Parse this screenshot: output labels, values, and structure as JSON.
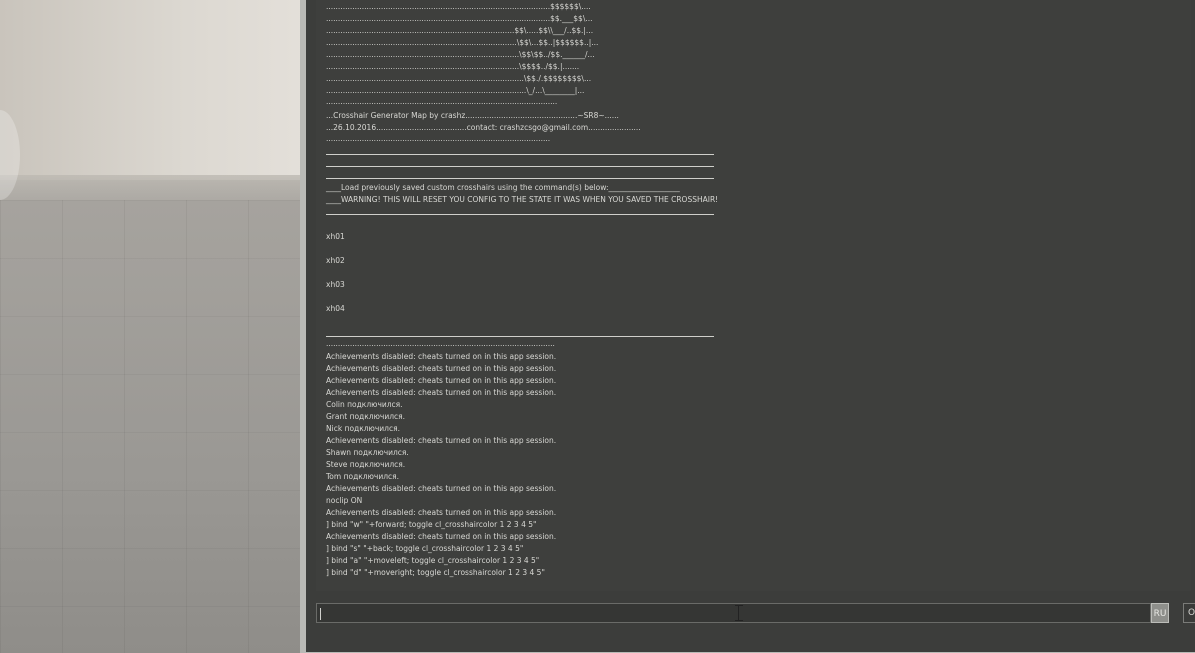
{
  "console": {
    "ascii_art": [
      "..............................................................................................$$$$$$\\....",
      "..............................................................................................$$.___$$\\...",
      "...............................................................................$$\\.....$$\\\\___/..$$.|...",
      "................................................................................\\$$\\...$$..|$$$$$$..|...",
      ".................................................................................\\$$\\$$../$$.______/...",
      ".................................................................................\\$$$$../$$.|.......",
      "...................................................................................\\$$./.$$$$$$$$\\...",
      "....................................................................................\\_/...\\________|...",
      "................................................................................................."
    ],
    "header_line_1": "...Crosshair Generator Map by crashz...............................................~SR8~......",
    "header_line_2": "...26.10.2016......................................contact: crashzcsgo@gmail.com......................",
    "header_dots": "..............................................................................................",
    "load_line": "____Load previously saved custom crosshairs using the command(s) below:___________________",
    "warning_line": "____WARNING! THIS WILL RESET YOU CONFIG TO THE STATE IT WAS WHEN YOU SAVED THE CROSSHAIR!",
    "commands": [
      "xh01",
      "xh02",
      "xh03",
      "xh04"
    ],
    "footer_dots": "................................................................................................",
    "log": [
      "Achievements disabled: cheats turned on in this app session.",
      "Achievements disabled: cheats turned on in this app session.",
      "Achievements disabled: cheats turned on in this app session.",
      "Achievements disabled: cheats turned on in this app session.",
      "Colin подключился.",
      "Grant подключился.",
      "Nick подключился.",
      "Achievements disabled: cheats turned on in this app session.",
      "Shawn подключился.",
      "Steve подключился.",
      "Tom подключился.",
      "Achievements disabled: cheats turned on in this app session.",
      "noclip ON",
      "Achievements disabled: cheats turned on in this app session.",
      "] bind \"w\" \"+forward; toggle cl_crosshaircolor 1 2 3 4 5\"",
      "Achievements disabled: cheats turned on in this app session.",
      "] bind \"s\" \"+back; toggle cl_crosshaircolor 1 2 3 4 5\"",
      "] bind \"a\" \"+moveleft; toggle cl_crosshaircolor 1 2 3 4 5\"",
      "] bind \"d\" \"+moveright; toggle cl_crosshaircolor 1 2 3 4 5\""
    ]
  },
  "input": {
    "value": "",
    "language_badge": "RU",
    "submit_label": "Ot"
  }
}
